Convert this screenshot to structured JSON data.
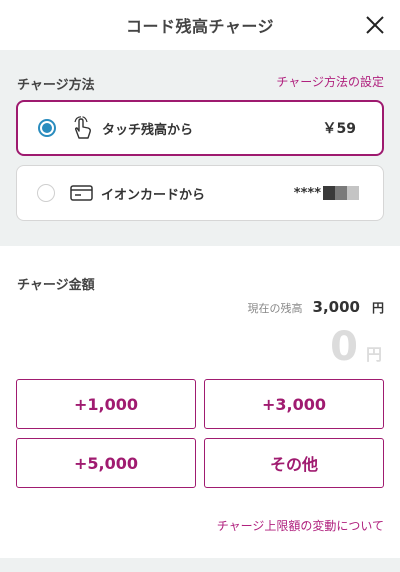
{
  "header": {
    "title": "コード残高チャージ"
  },
  "method": {
    "title": "チャージ方法",
    "settings_link": "チャージ方法の設定",
    "options": [
      {
        "label": "タッチ残高から",
        "value": "￥59",
        "selected": true,
        "icon": "hand-tap-icon"
      },
      {
        "label": "イオンカードから",
        "value": "****",
        "selected": false,
        "icon": "credit-card-icon"
      }
    ]
  },
  "amount": {
    "title": "チャージ金額",
    "balance_label": "現在の残高",
    "balance_value": "3,000",
    "balance_unit": "円",
    "current_amount": "0",
    "current_unit": "円",
    "buttons": [
      "+1,000",
      "+3,000",
      "+5,000",
      "その他"
    ],
    "limit_link": "チャージ上限額の変動について"
  },
  "colors": {
    "accent": "#a01b70",
    "radio_selected": "#2a8cbe",
    "page_bg": "#eef1f1"
  }
}
